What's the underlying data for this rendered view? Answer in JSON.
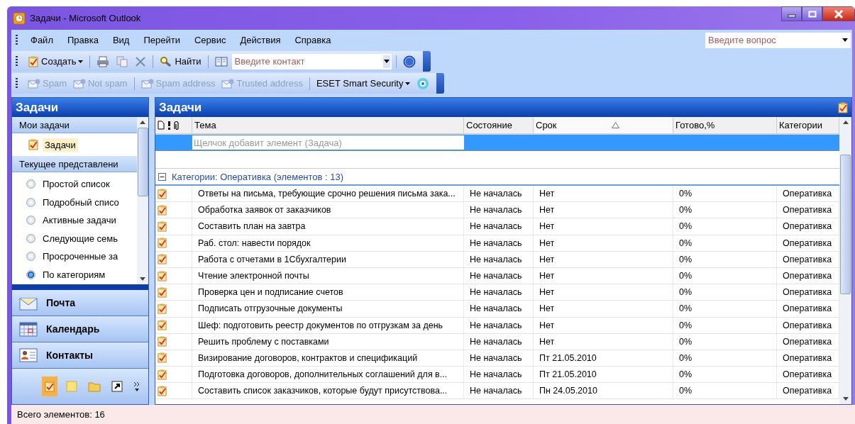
{
  "window": {
    "title": "Задачи - Microsoft Outlook"
  },
  "menu": [
    "Файл",
    "Правка",
    "Вид",
    "Перейти",
    "Сервис",
    "Действия",
    "Справка"
  ],
  "help_search": {
    "placeholder": "Введите вопрос"
  },
  "toolbar": {
    "new_label": "Создать",
    "find_label": "Найти",
    "contact_search": {
      "placeholder": "Введите контакт"
    }
  },
  "spam_toolbar": [
    {
      "kind": "spam",
      "label": "Spam",
      "disabled": true
    },
    {
      "kind": "notspam",
      "label": "Not spam",
      "disabled": true
    },
    {
      "kind": "spamaddr",
      "label": "Spam address",
      "disabled": true
    },
    {
      "kind": "trusted",
      "label": "Trusted address",
      "disabled": true
    },
    {
      "kind": "menu",
      "label": "ESET Smart Security",
      "disabled": false
    }
  ],
  "navigation": {
    "title": "Задачи",
    "my_tasks_header": "Мои задачи",
    "folders": [
      {
        "label": "Задачи",
        "selected": true
      }
    ],
    "views_header": "Текущее представлени",
    "views": [
      {
        "label": "Простой список",
        "selected": false
      },
      {
        "label": "Подробный списо",
        "selected": false
      },
      {
        "label": "Активные задачи",
        "selected": false
      },
      {
        "label": "Следующие семь",
        "selected": false
      },
      {
        "label": "Просроченные за",
        "selected": false
      },
      {
        "label": "По категориям",
        "selected": true
      }
    ],
    "buttons": [
      {
        "kind": "mail",
        "label": "Почта"
      },
      {
        "kind": "calendar",
        "label": "Календарь"
      },
      {
        "kind": "contacts",
        "label": "Контакты"
      }
    ]
  },
  "task_list": {
    "title": "Задачи",
    "columns": [
      {
        "label": "Тема",
        "sorted": false
      },
      {
        "label": "Состояние",
        "sorted": false
      },
      {
        "label": "Срок",
        "sorted": true
      },
      {
        "label": "Готово,%",
        "sorted": false
      },
      {
        "label": "Категории",
        "sorted": false
      }
    ],
    "new_item_placeholder": "Щелчок добавит элемент (Задача)",
    "group": {
      "label": "Категории: Оперативка (элементов : 13)",
      "expanded": true
    },
    "rows": [
      {
        "subject": "Ответы на письма, требующие срочно решения письма зака...",
        "status": "Не началась",
        "due": "Нет",
        "percent": "0%",
        "category": "Оперативка"
      },
      {
        "subject": "Обработка заявок от заказчиков",
        "status": "Не началась",
        "due": "Нет",
        "percent": "0%",
        "category": "Оперативка"
      },
      {
        "subject": "Составить план на завтра",
        "status": "Не началась",
        "due": "Нет",
        "percent": "0%",
        "category": "Оперативка"
      },
      {
        "subject": "Раб. стол: навести порядок",
        "status": "Не началась",
        "due": "Нет",
        "percent": "0%",
        "category": "Оперативка"
      },
      {
        "subject": "Работа с отчетами в 1Сбухгалтерии",
        "status": "Не началась",
        "due": "Нет",
        "percent": "0%",
        "category": "Оперативка"
      },
      {
        "subject": "Чтение электронной почты",
        "status": "Не началась",
        "due": "Нет",
        "percent": "0%",
        "category": "Оперативка"
      },
      {
        "subject": "Проверка цен и подписание счетов",
        "status": "Не началась",
        "due": "Нет",
        "percent": "0%",
        "category": "Оперативка"
      },
      {
        "subject": "Подписать отгрузочные документы",
        "status": "Не началась",
        "due": "Нет",
        "percent": "0%",
        "category": "Оперативка"
      },
      {
        "subject": "Шеф: подготовить реестр документов по отгрузкам за день",
        "status": "Не началась",
        "due": "Нет",
        "percent": "0%",
        "category": "Оперативка"
      },
      {
        "subject": "Решить проблему с поставками",
        "status": "Не началась",
        "due": "Нет",
        "percent": "0%",
        "category": "Оперативка"
      },
      {
        "subject": "Визирование договоров, контрактов и спецификаций",
        "status": "Не началась",
        "due": "Пт 21.05.2010",
        "percent": "0%",
        "category": "Оперативка"
      },
      {
        "subject": "Подготовка договоров, дополнительных соглашений для в...",
        "status": "Не началась",
        "due": "Пт 21.05.2010",
        "percent": "0%",
        "category": "Оперативка"
      },
      {
        "subject": "Составить список заказчиков, которые будут присутствова...",
        "status": "Не началась",
        "due": "Пн 24.05.2010",
        "percent": "0%",
        "category": "Оперативка"
      }
    ]
  },
  "status_bar": "Всего элементов: 16"
}
